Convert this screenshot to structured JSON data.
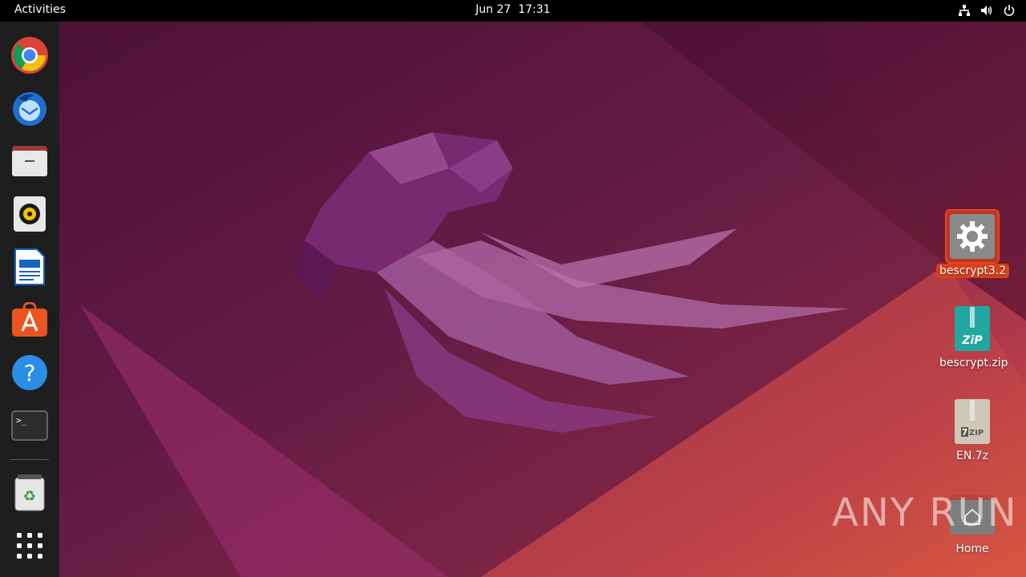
{
  "topbar": {
    "activities": "Activities",
    "date": "Jun 27",
    "time": "17:31",
    "tray": [
      "network-icon",
      "volume-icon",
      "power-icon"
    ]
  },
  "dock": {
    "items": [
      {
        "name": "chrome",
        "icon": "chrome-icon"
      },
      {
        "name": "thunderbird",
        "icon": "thunderbird-icon"
      },
      {
        "name": "files",
        "icon": "files-icon"
      },
      {
        "name": "rhythmbox",
        "icon": "rhythmbox-icon"
      },
      {
        "name": "writer",
        "icon": "libreoffice-writer-icon"
      },
      {
        "name": "software",
        "icon": "app-center-icon"
      },
      {
        "name": "help",
        "icon": "help-icon"
      },
      {
        "name": "terminal",
        "icon": "terminal-icon"
      },
      {
        "name": "trash",
        "icon": "trash-icon"
      },
      {
        "name": "show-apps",
        "icon": "app-grid-icon"
      }
    ]
  },
  "desktop": {
    "icons": [
      {
        "label": "bescrypt3.2",
        "icon": "gear-icon",
        "selected": true
      },
      {
        "label": "bescrypt.zip",
        "icon": "zip-archive-icon"
      },
      {
        "label": "EN.7z",
        "icon": "7z-archive-icon"
      },
      {
        "label": "Home",
        "icon": "home-folder-icon"
      }
    ]
  },
  "watermark": "ANY RUN",
  "colors": {
    "accent": "#e95420",
    "topbar": "#000000",
    "dock": "#1e1e1e"
  }
}
